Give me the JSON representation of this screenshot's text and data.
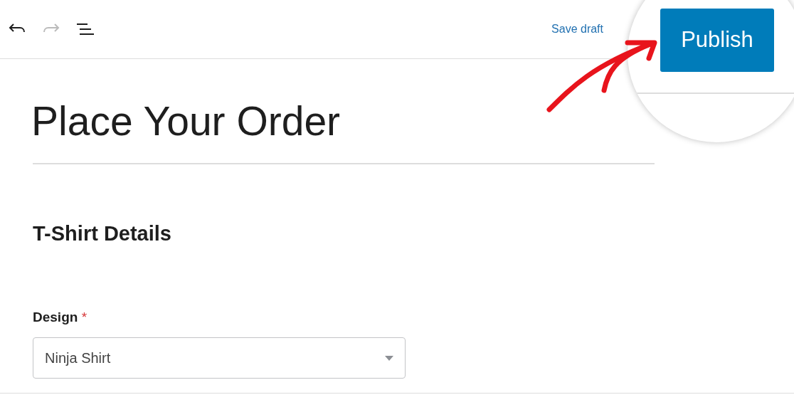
{
  "toolbar": {
    "undo": {
      "disabled": false
    },
    "redo": {
      "disabled": true
    },
    "save_draft": "Save draft",
    "publish": "Publish"
  },
  "page": {
    "title": "Place Your Order",
    "section": "T-Shirt Details",
    "field": {
      "label": "Design",
      "required_mark": "*",
      "value": "Ninja Shirt"
    }
  }
}
